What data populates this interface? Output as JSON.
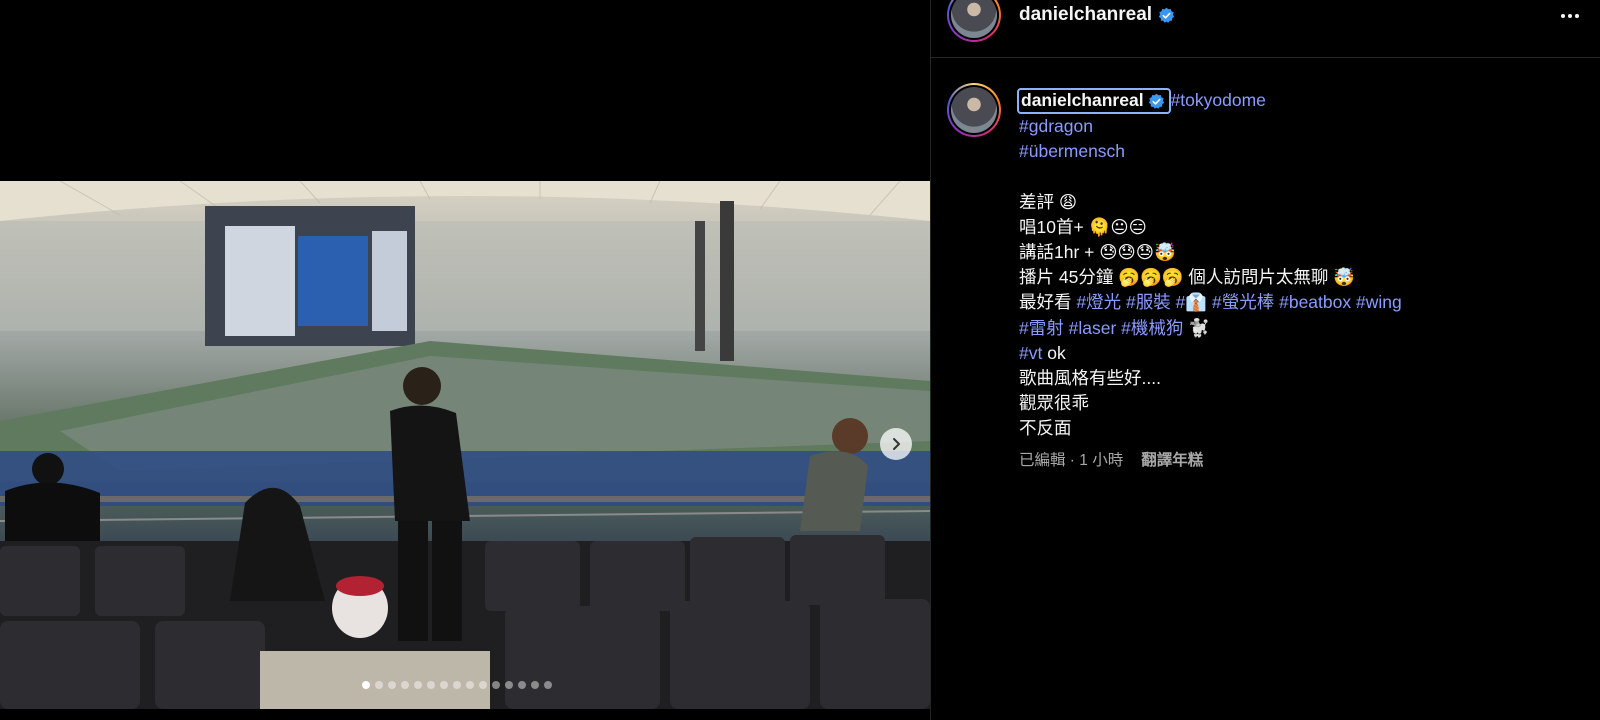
{
  "post": {
    "username": "danielchanreal",
    "verified_icon": "verified-badge-icon",
    "more_icon": "more-options-icon"
  },
  "caption": {
    "username": "danielchanreal",
    "hashtags_top": [
      "#tokyodome",
      "#gdragon",
      "#übermensch"
    ],
    "lines": {
      "l1": "差評 😩",
      "l2": "唱10首+ 🫠😐😑",
      "l3": "講話1hr + 😓😓😓🤯",
      "l4a": "播片 45分鐘 🥱🥱🥱 個人訪問片太無聊 🤯",
      "l5_prefix": "最好看 ",
      "l5_tags": [
        "#燈光",
        "#服裝",
        "#👔",
        "#螢光棒",
        "#beatbox",
        "#wing"
      ],
      "l6_tags": [
        "#雷射",
        "#laser",
        "#機械狗"
      ],
      "l6_suffix": " 🐩",
      "l7_tag": "#vt",
      "l7_suffix": " ok",
      "l8": "歌曲風格有些好....",
      "l9": "觀眾很乖",
      "l10": "不反面"
    },
    "edited": "已編輯 · 1 小時",
    "translate": "翻譯年糕"
  },
  "carousel": {
    "total": 15,
    "active_index": 0,
    "next_icon": "chevron-right-icon"
  },
  "colors": {
    "background": "#000000",
    "hashtag": "#8a9cff",
    "verified": "#3897f0",
    "muted": "#a8a8a8"
  }
}
